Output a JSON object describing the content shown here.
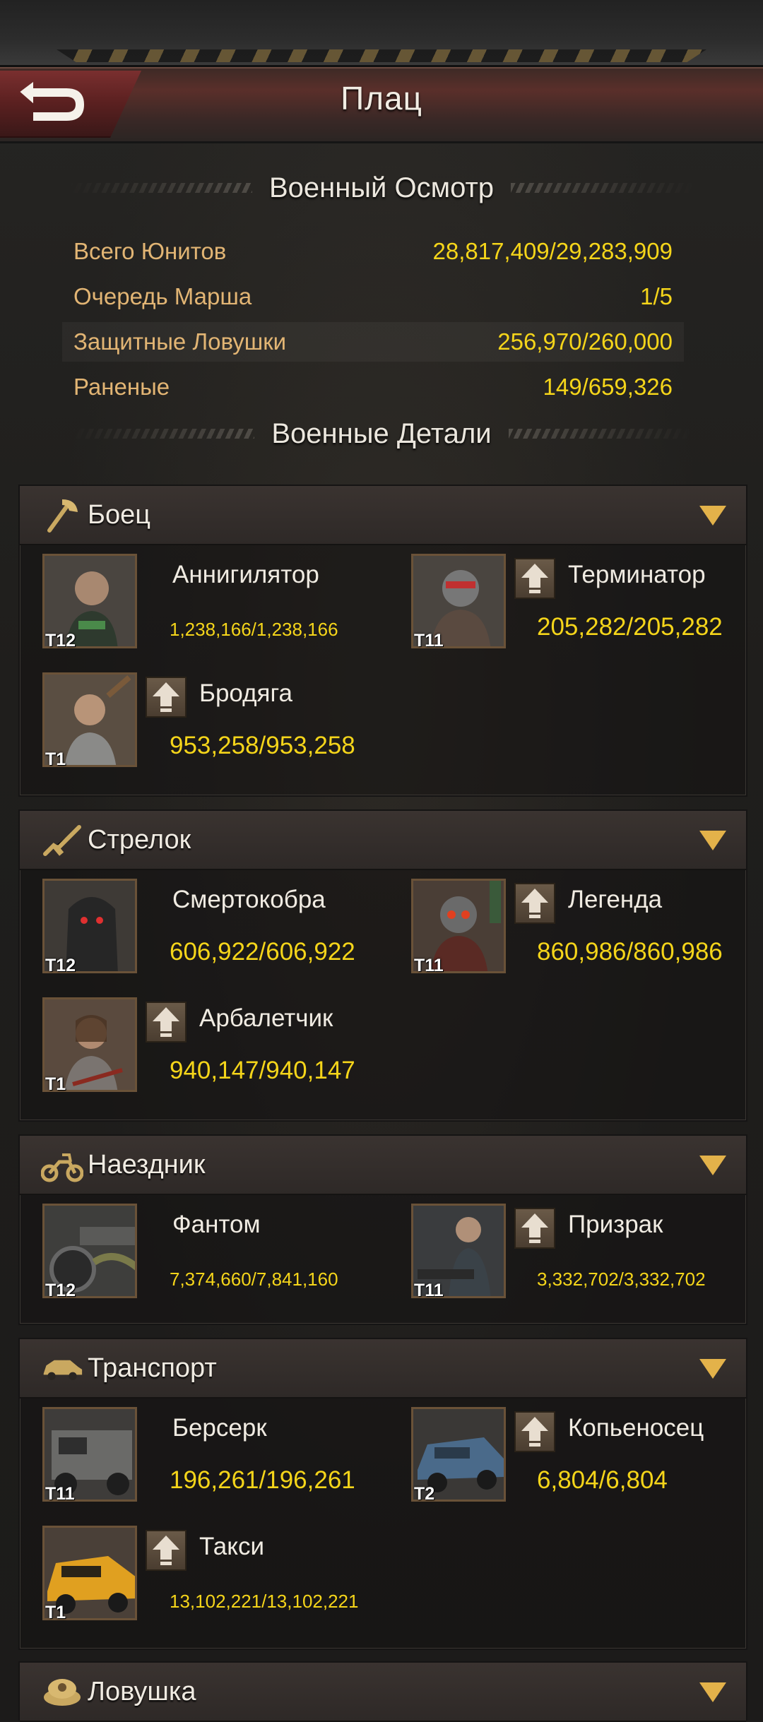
{
  "header": {
    "title": "Плац"
  },
  "inspection": {
    "title": "Военный Осмотр",
    "stats": [
      {
        "label": "Всего Юнитов",
        "value": "28,817,409/29,283,909"
      },
      {
        "label": "Очередь Марша",
        "value": "1/5"
      },
      {
        "label": "Защитные Ловушки",
        "value": "256,970/260,000"
      },
      {
        "label": "Раненые",
        "value": "149/659,326"
      }
    ]
  },
  "details": {
    "title": "Военные Детали"
  },
  "categories": [
    {
      "label": "Боец",
      "icon": "axe-icon",
      "units": [
        {
          "name": "Аннигилятор",
          "tier": "T12",
          "count": "1,238,166/1,238,166",
          "upgrade": false
        },
        {
          "name": "Терминатор",
          "tier": "T11",
          "count": "205,282/205,282",
          "upgrade": true
        },
        {
          "name": "Бродяга",
          "tier": "T1",
          "count": "953,258/953,258",
          "upgrade": true
        }
      ]
    },
    {
      "label": "Стрелок",
      "icon": "rifle-icon",
      "units": [
        {
          "name": "Смертокобра",
          "tier": "T12",
          "count": "606,922/606,922",
          "upgrade": false
        },
        {
          "name": "Легенда",
          "tier": "T11",
          "count": "860,986/860,986",
          "upgrade": true
        },
        {
          "name": "Арбалетчик",
          "tier": "T1",
          "count": "940,147/940,147",
          "upgrade": true
        }
      ]
    },
    {
      "label": "Наездник",
      "icon": "motorcycle-icon",
      "units": [
        {
          "name": "Фантом",
          "tier": "T12",
          "count": "7,374,660/7,841,160",
          "upgrade": false
        },
        {
          "name": "Призрак",
          "tier": "T11",
          "count": "3,332,702/3,332,702",
          "upgrade": true
        }
      ]
    },
    {
      "label": "Транспорт",
      "icon": "car-icon",
      "units": [
        {
          "name": "Берсерк",
          "tier": "T11",
          "count": "196,261/196,261",
          "upgrade": false
        },
        {
          "name": "Копьеносец",
          "tier": "T2",
          "count": "6,804/6,804",
          "upgrade": true
        },
        {
          "name": "Такси",
          "tier": "T1",
          "count": "13,102,221/13,102,221",
          "upgrade": true
        }
      ]
    },
    {
      "label": "Ловушка",
      "icon": "trap-icon",
      "units": []
    }
  ],
  "colors": {
    "accent_gold": "#f5d51a",
    "label_orange": "#e2b574",
    "back_red": "#7a2f2f"
  }
}
